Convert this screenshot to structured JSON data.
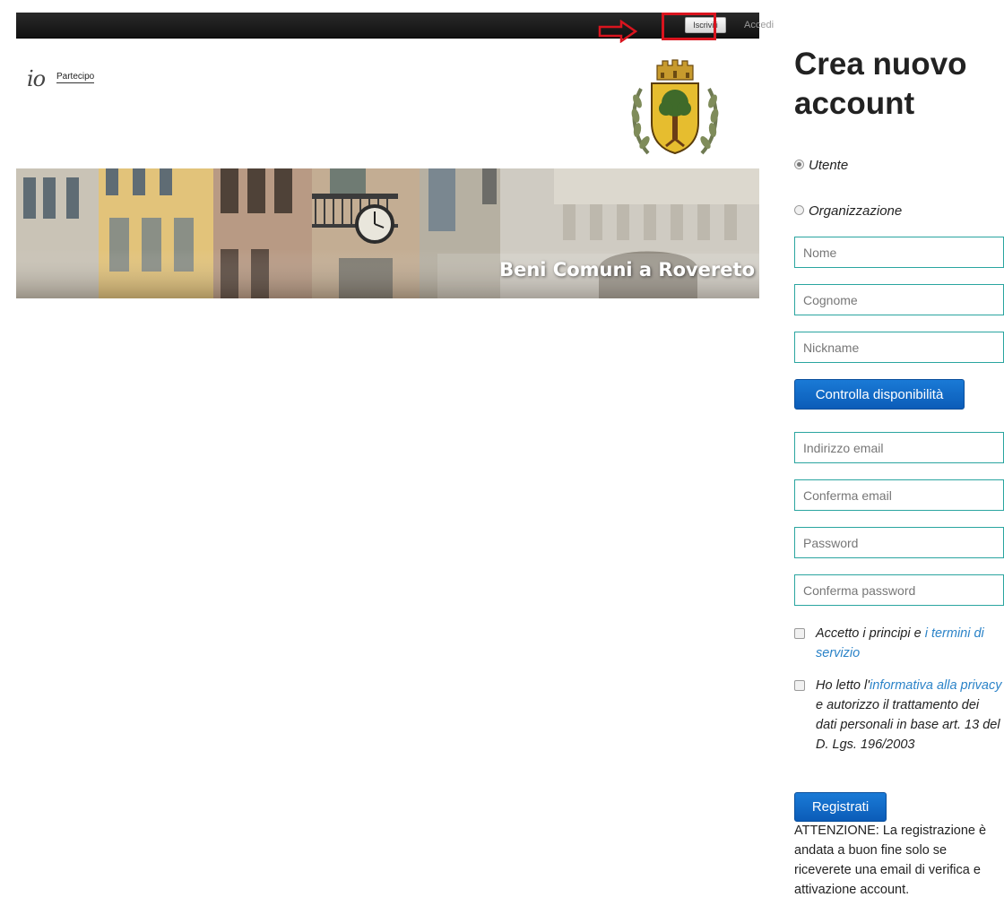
{
  "topbar": {
    "signup_label": "Iscriviti",
    "login_label": "Accedi"
  },
  "logo": {
    "prefix": "io",
    "text": "Partecipo"
  },
  "banner": {
    "title": "Beni Comuni a Rovereto"
  },
  "form": {
    "title": "Crea nuovo account",
    "account_types": [
      {
        "label": "Utente",
        "selected": true
      },
      {
        "label": "Organizzazione",
        "selected": false
      }
    ],
    "fields": {
      "nome": "Nome",
      "cognome": "Cognome",
      "nickname": "Nickname",
      "email": "Indirizzo email",
      "confirm_email": "Conferma email",
      "password": "Password",
      "confirm_password": "Conferma password"
    },
    "check_availability_label": "Controlla disponibilità",
    "terms": {
      "prefix": "Accetto i principi e ",
      "link": "i termini di servizio",
      "checked": false
    },
    "privacy": {
      "prefix": "Ho letto l'",
      "link": "informativa alla privacy",
      "suffix": " e autorizzo il trattamento dei dati personali in base art. 13 del D. Lgs. 196/2003",
      "checked": false
    },
    "register_label": "Registrati",
    "warning": "ATTENZIONE: La registrazione è andata a buon fine solo se riceverete una email di verifica e attivazione account."
  },
  "colors": {
    "accent_blue": "#0b5cb8",
    "field_border": "#2aa5a0",
    "highlight_red": "#d9141e",
    "link": "#2b83c8"
  },
  "icons": [
    "right-arrow-icon",
    "coat-of-arms-icon"
  ]
}
